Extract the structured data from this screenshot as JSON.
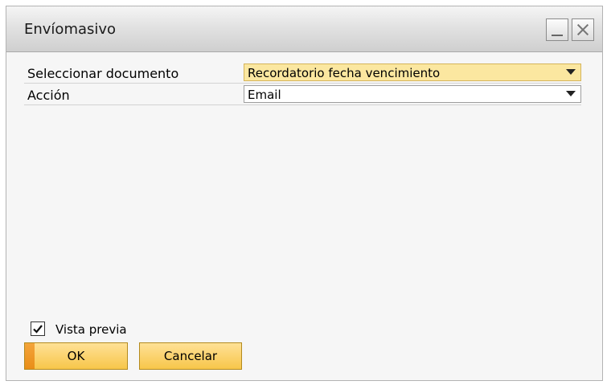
{
  "window": {
    "title": "Envíomasivo"
  },
  "form": {
    "select_document_label": "Seleccionar documento",
    "select_document_value": "Recordatorio fecha vencimiento",
    "action_label": "Acción",
    "action_value": "Email"
  },
  "preview": {
    "label": "Vista previa",
    "checked": true
  },
  "buttons": {
    "ok_label": "OK",
    "cancel_label": "Cancelar"
  },
  "colors": {
    "highlight_field": "#fbe7a0",
    "button_fill": "#f7c64a",
    "ok_accent": "#e98e18"
  }
}
